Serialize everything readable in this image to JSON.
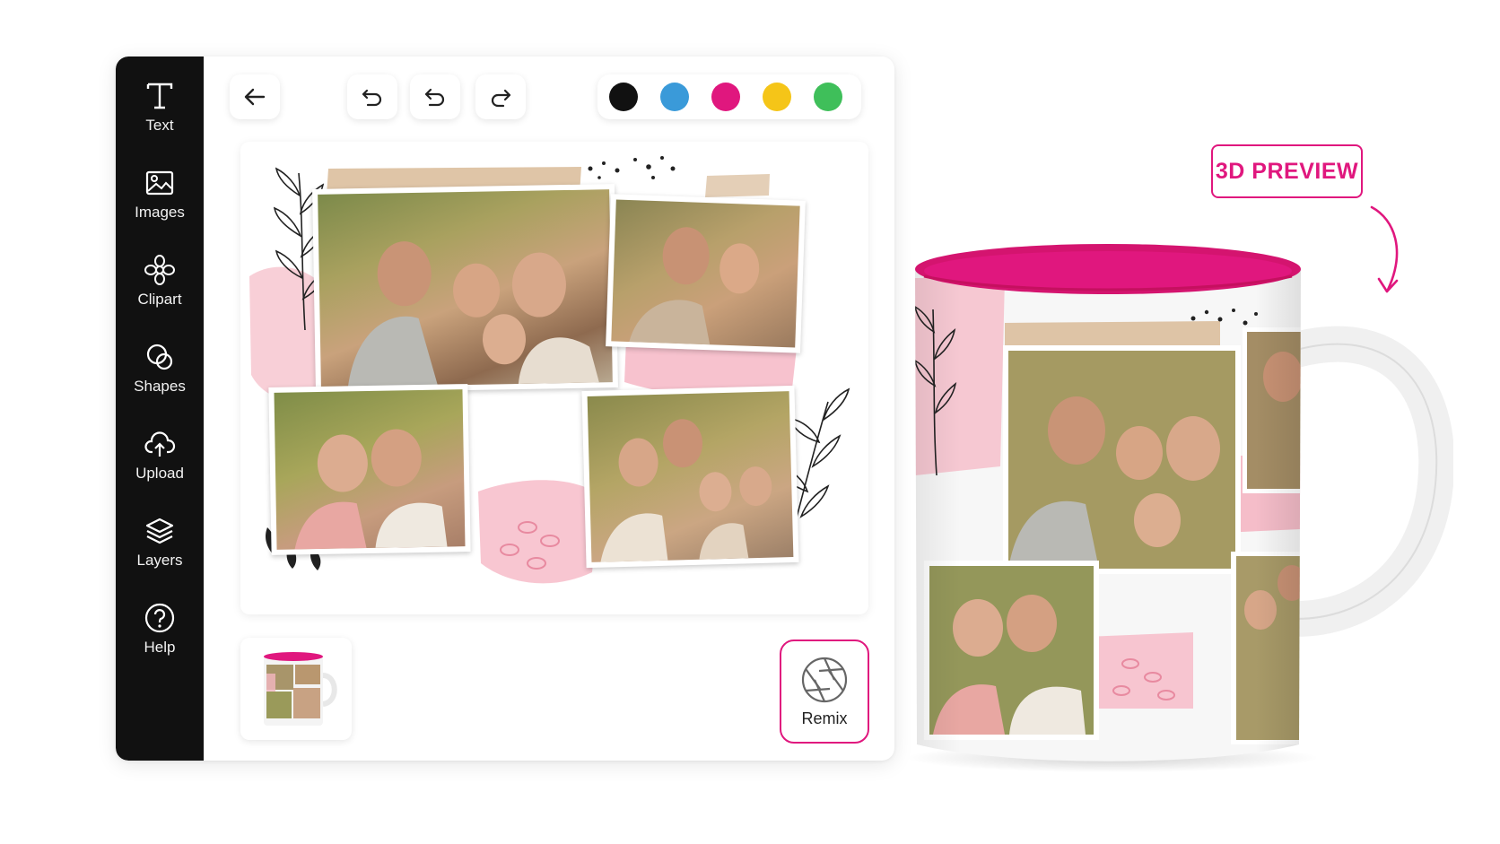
{
  "sidebar": {
    "items": [
      {
        "label": "Text",
        "icon": "text-icon"
      },
      {
        "label": "Images",
        "icon": "image-icon"
      },
      {
        "label": "Clipart",
        "icon": "flower-icon"
      },
      {
        "label": "Shapes",
        "icon": "shapes-icon"
      },
      {
        "label": "Upload",
        "icon": "cloud-upload-icon"
      },
      {
        "label": "Layers",
        "icon": "layers-icon"
      },
      {
        "label": "Help",
        "icon": "help-icon"
      }
    ]
  },
  "toolbar": {
    "back_icon": "back-arrow-icon",
    "undo_icon": "undo-icon",
    "undo2_icon": "undo-icon",
    "redo_icon": "redo-icon"
  },
  "palette": {
    "colors": [
      "#111111",
      "#3a9ad9",
      "#e0177e",
      "#f5c518",
      "#3fbf5a"
    ]
  },
  "remix": {
    "label": "Remix",
    "icon": "aperture-icon"
  },
  "preview": {
    "badge": "3D PREVIEW",
    "accent": "#e0177e"
  }
}
